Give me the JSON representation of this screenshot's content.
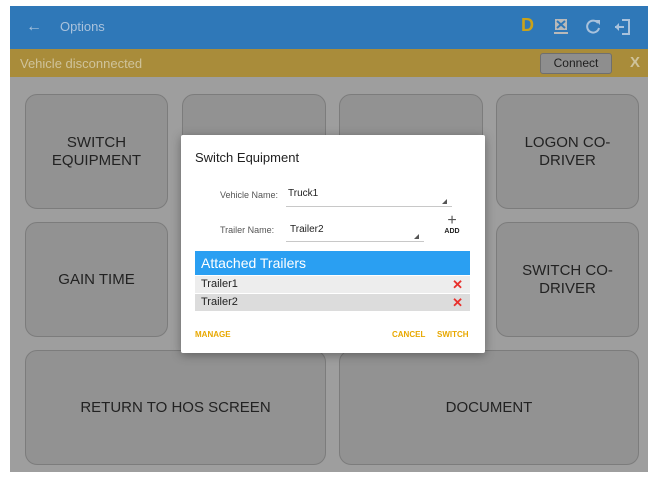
{
  "appbar": {
    "title": "Options",
    "back_icon": "arrow-left-icon",
    "d_badge": "D",
    "icons": [
      "device-disconnect-icon",
      "refresh-icon",
      "logout-icon"
    ],
    "color": "#2f78b8"
  },
  "status": {
    "message": "Vehicle disconnected",
    "connect_label": "Connect",
    "close_label": "X"
  },
  "tiles": {
    "switch_equipment": "SWITCH\nEQUIPMENT",
    "logon_co_driver": "LOGON CO-DRIVER",
    "gain_time": "GAIN TIME",
    "switch_co_driver": "SWITCH CO-\nDRIVER",
    "return_hos": "RETURN TO HOS SCREEN",
    "document": "DOCUMENT"
  },
  "dialog": {
    "title": "Switch Equipment",
    "vehicle_label": "Vehicle Name:",
    "vehicle_value": "Truck1",
    "trailer_label": "Trailer Name:",
    "trailer_value": "Trailer2",
    "add_label": "ADD",
    "attached_header": "Attached Trailers",
    "trailers": [
      "Trailer1",
      "Trailer2"
    ],
    "manage_label": "MANAGE",
    "cancel_label": "CANCEL",
    "switch_label": "SWITCH"
  },
  "colors": {
    "accent": "#2a9ff2",
    "action": "#e8a800",
    "remove": "#e8302c",
    "status_bar": "#a98c3a"
  }
}
